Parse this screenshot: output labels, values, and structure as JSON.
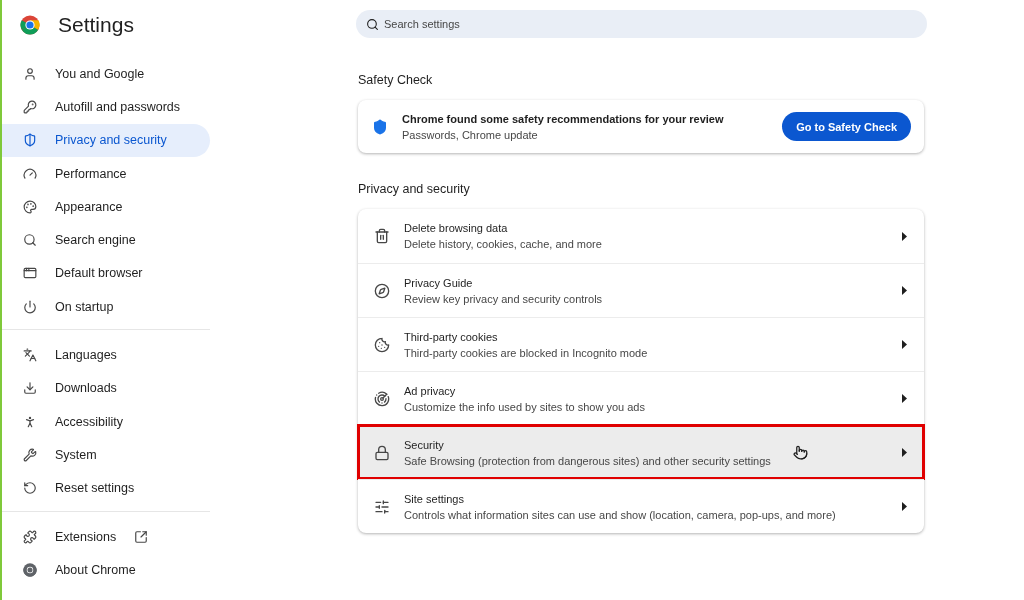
{
  "header": {
    "title": "Settings"
  },
  "sidebar": {
    "groups": [
      {
        "items": [
          {
            "label": "You and Google",
            "selected": false
          },
          {
            "label": "Autofill and passwords",
            "selected": false
          },
          {
            "label": "Privacy and security",
            "selected": true
          },
          {
            "label": "Performance",
            "selected": false
          },
          {
            "label": "Appearance",
            "selected": false
          },
          {
            "label": "Search engine",
            "selected": false
          },
          {
            "label": "Default browser",
            "selected": false
          },
          {
            "label": "On startup",
            "selected": false
          }
        ]
      },
      {
        "items": [
          {
            "label": "Languages",
            "selected": false
          },
          {
            "label": "Downloads",
            "selected": false
          },
          {
            "label": "Accessibility",
            "selected": false
          },
          {
            "label": "System",
            "selected": false
          },
          {
            "label": "Reset settings",
            "selected": false
          }
        ]
      },
      {
        "items": [
          {
            "label": "Extensions",
            "selected": false,
            "kind": "external"
          },
          {
            "label": "About Chrome",
            "selected": false,
            "kind": "plain"
          }
        ]
      }
    ]
  },
  "search": {
    "placeholder": "Search settings"
  },
  "safety_check": {
    "heading": "Safety Check",
    "title": "Chrome found some safety recommendations for your review",
    "subtitle": "Passwords, Chrome update",
    "button": "Go to Safety Check"
  },
  "privacy": {
    "heading": "Privacy and security",
    "rows": [
      {
        "title": "Delete browsing data",
        "subtitle": "Delete history, cookies, cache, and more",
        "highlighted": false
      },
      {
        "title": "Privacy Guide",
        "subtitle": "Review key privacy and security controls",
        "highlighted": false
      },
      {
        "title": "Third-party cookies",
        "subtitle": "Third-party cookies are blocked in Incognito mode",
        "highlighted": false
      },
      {
        "title": "Ad privacy",
        "subtitle": "Customize the info used by sites to show you ads",
        "highlighted": false
      },
      {
        "title": "Security",
        "subtitle": "Safe Browsing (protection from dangerous sites) and other security settings",
        "highlighted": true
      },
      {
        "title": "Site settings",
        "subtitle": "Controls what information sites can use and show (location, camera, pop-ups, and more)",
        "highlighted": false
      }
    ]
  }
}
